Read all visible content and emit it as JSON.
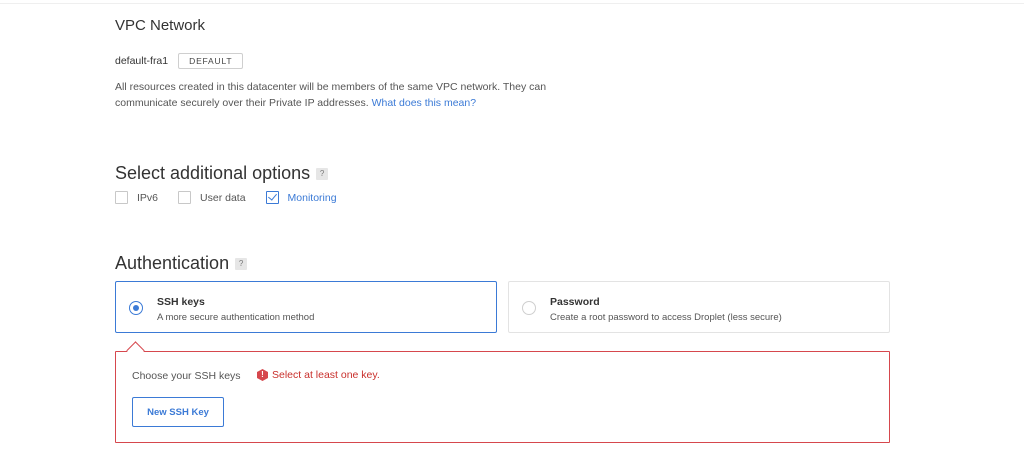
{
  "vpc": {
    "title": "VPC Network",
    "name": "default-fra1",
    "badge": "DEFAULT",
    "description": "All resources created in this datacenter will be members of the same VPC network. They can communicate securely over their Private IP addresses.",
    "link": "What does this mean?"
  },
  "options": {
    "title": "Select additional options",
    "help": "?",
    "items": [
      {
        "label": "IPv6",
        "checked": false
      },
      {
        "label": "User data",
        "checked": false
      },
      {
        "label": "Monitoring",
        "checked": true
      }
    ]
  },
  "auth": {
    "title": "Authentication",
    "help": "?",
    "methods": [
      {
        "title": "SSH keys",
        "subtitle": "A more secure authentication method",
        "selected": true
      },
      {
        "title": "Password",
        "subtitle": "Create a root password to access Droplet (less secure)",
        "selected": false
      }
    ],
    "ssh": {
      "choose_label": "Choose your SSH keys",
      "error_icon": "!",
      "error": "Select at least one key.",
      "new_key_button": "New SSH Key"
    }
  },
  "colors": {
    "accent": "#3b7ad6",
    "error": "#d6474d"
  }
}
